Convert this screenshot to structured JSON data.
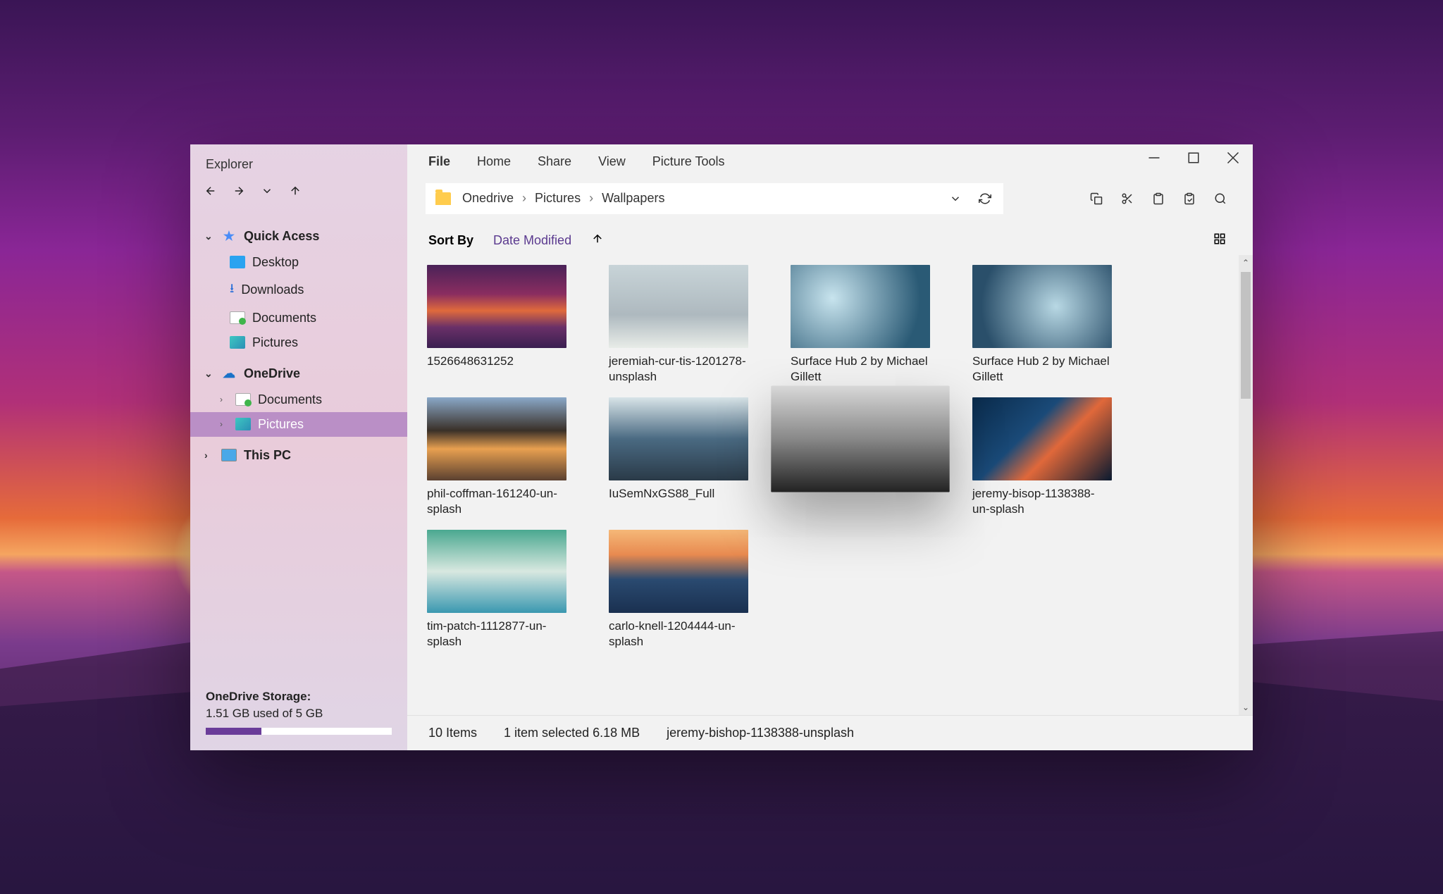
{
  "app": {
    "title": "Explorer"
  },
  "nav": {
    "back": "←",
    "forward": "→",
    "down": "⌄",
    "up": "↑"
  },
  "tree": {
    "quickAccess": {
      "label": "Quick Acess",
      "items": [
        {
          "label": "Desktop"
        },
        {
          "label": "Downloads"
        },
        {
          "label": "Documents"
        },
        {
          "label": "Pictures"
        }
      ]
    },
    "oneDrive": {
      "label": "OneDrive",
      "items": [
        {
          "label": "Documents"
        },
        {
          "label": "Pictures",
          "selected": true
        }
      ]
    },
    "thisPC": {
      "label": "This PC"
    }
  },
  "storage": {
    "title": "OneDrive Storage:",
    "text": "1.51 GB used of 5 GB",
    "percent": 30
  },
  "ribbon": [
    "File",
    "Home",
    "Share",
    "View",
    "Picture Tools"
  ],
  "breadcrumb": [
    "Onedrive",
    "Pictures",
    "Wallpapers"
  ],
  "toolbar": {
    "historyDropdown": "⌄",
    "refresh": "⟳",
    "copy": "⧉",
    "cut": "✀",
    "paste": "📋",
    "pasteShortcut": "🗂",
    "search": "🔍"
  },
  "sort": {
    "label": "Sort By",
    "option": "Date Modified",
    "direction": "↑"
  },
  "viewToggle": "⊞",
  "files": [
    {
      "name": "1526648631252"
    },
    {
      "name": "jeremiah-cur-tis-1201278-unsplash"
    },
    {
      "name": "Surface Hub 2 by Michael Gillett"
    },
    {
      "name": "Surface Hub 2 by Michael Gillett"
    },
    {
      "name": "phil-coffman-161240-un-splash"
    },
    {
      "name": "IuSemNxGS88_Full"
    },
    {
      "name": "",
      "hovered": true
    },
    {
      "name": "jeremy-bisop-1138388-un-splash"
    },
    {
      "name": "tim-patch-1112877-un-splash"
    },
    {
      "name": "carlo-knell-1204444-un-splash"
    }
  ],
  "status": {
    "count": "10 Items",
    "selection": "1 item selected 6.18 MB",
    "selectedName": "jeremy-bishop-1138388-unsplash"
  },
  "windowControls": {
    "min": "—",
    "max": "▢",
    "close": "✕"
  }
}
